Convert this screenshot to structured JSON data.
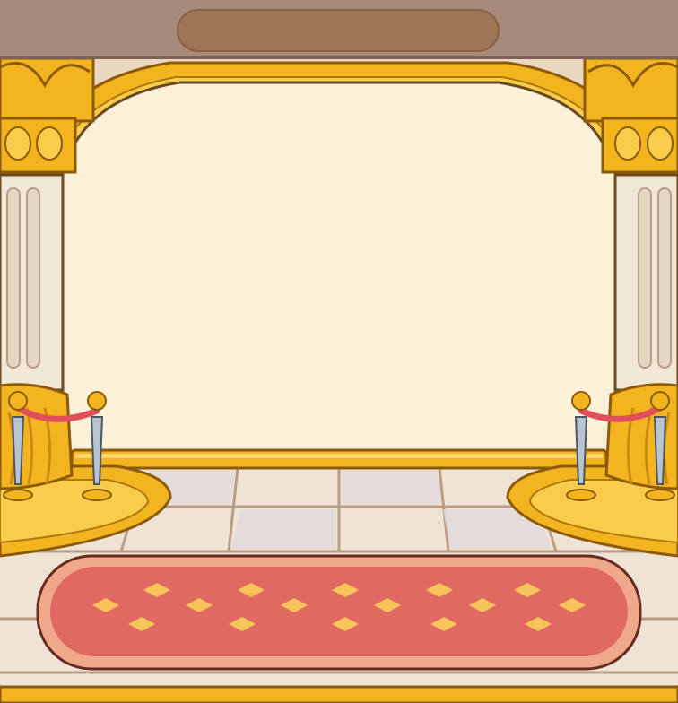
{
  "scene": {
    "name": "palace stage",
    "title_text": "",
    "colors": {
      "screen": "#fbf0d8",
      "gold": "#f2b520",
      "gold_dark": "#c98a0e",
      "carpet": "#e06a62",
      "carpet_border": "#f0a88a",
      "carpet_diamond": "#f8c35a",
      "rope": "#e0505a",
      "floor_light": "#f2e4cf",
      "floor_dark": "#e0d8d8",
      "title_bar": "#a78a79",
      "title_pill": "#9e7457"
    },
    "elements": {
      "left_pillar": "fluted-column",
      "right_pillar": "fluted-column",
      "arch": "golden-arch",
      "stanchions": 4,
      "carpet": "red-carpet-with-diamonds"
    }
  }
}
